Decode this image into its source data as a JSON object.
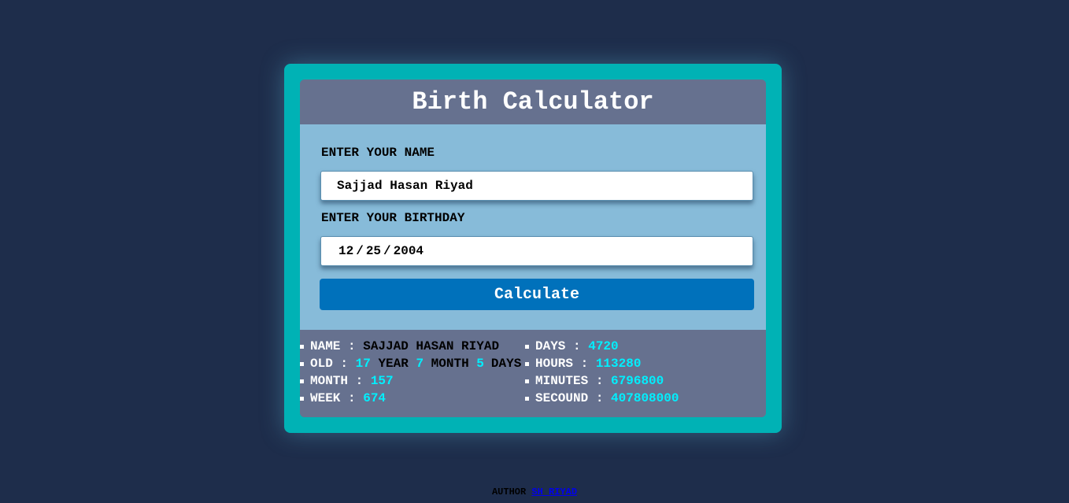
{
  "app": {
    "title": "Birth Calculator"
  },
  "form": {
    "name_label": "ENTER YOUR NAME",
    "name_value": "Sajjad Hasan Riyad",
    "birthday_label": "ENTER YOUR BIRTHDAY",
    "birthday_month": "12",
    "birthday_day": "25",
    "birthday_year": "2004",
    "date_separator": "/",
    "calculate_label": "Calculate"
  },
  "results": {
    "name_key": "NAME :",
    "name_value": "SAJJAD HASAN RIYAD",
    "old_key": "OLD :",
    "old_years": "17",
    "old_year_word": "YEAR",
    "old_months": "7",
    "old_month_word": "MONTH",
    "old_days": "5",
    "old_days_word": "DAYS",
    "month_key": "MONTH :",
    "month_value": "157",
    "week_key": "WEEK :",
    "week_value": "674",
    "days_key": "DAYS :",
    "days_value": "4720",
    "hours_key": "HOURS :",
    "hours_value": "113280",
    "minutes_key": "MINUTES :",
    "minutes_value": "6796800",
    "seconds_key": "SECOUND :",
    "seconds_value": "407808000"
  },
  "footer": {
    "author_label": "AUTHOR",
    "author_link": "SH RIYAD"
  },
  "colors": {
    "page_bg": "#1e2d4b",
    "frame": "#00b2b5",
    "header_bg": "#66718f",
    "form_bg": "#87bbd9",
    "button_bg": "#0071bb",
    "result_value": "#00f0ff"
  }
}
